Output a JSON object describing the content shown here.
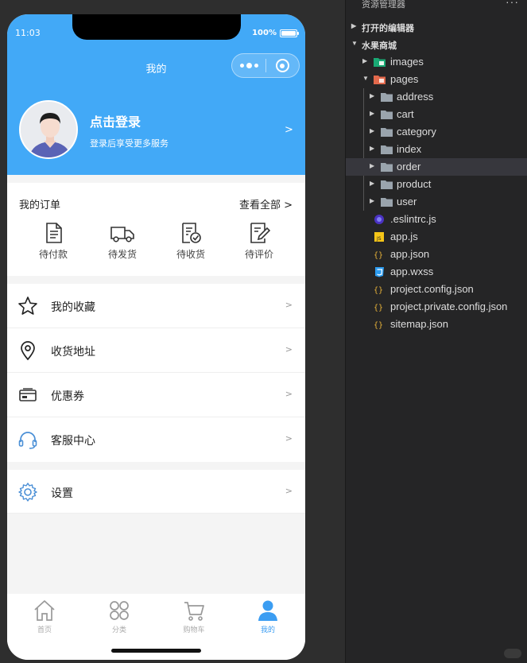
{
  "status": {
    "time": "11:03",
    "battery": "100%",
    "battery_level": 1.0
  },
  "nav": {
    "title": "我的"
  },
  "profile": {
    "login_title": "点击登录",
    "login_subtitle": "登录后享受更多服务",
    "arrow": ">"
  },
  "orders": {
    "title": "我的订单",
    "view_all": "查看全部 >",
    "items": [
      {
        "label": "待付款",
        "icon": "document-icon"
      },
      {
        "label": "待发货",
        "icon": "truck-icon"
      },
      {
        "label": "待收货",
        "icon": "checklist-icon"
      },
      {
        "label": "待评价",
        "icon": "review-pen-icon"
      }
    ]
  },
  "menu": {
    "items": [
      {
        "label": "我的收藏",
        "icon": "star-icon",
        "arrow": ">"
      },
      {
        "label": "收货地址",
        "icon": "location-pin-icon",
        "arrow": ">"
      },
      {
        "label": "优惠券",
        "icon": "coupon-icon",
        "arrow": ">"
      },
      {
        "label": "客服中心",
        "icon": "headset-icon",
        "arrow": ">"
      }
    ],
    "settings": {
      "label": "设置",
      "icon": "gear-icon",
      "arrow": ">"
    }
  },
  "tabbar": {
    "items": [
      {
        "label": "首页",
        "icon": "home-icon"
      },
      {
        "label": "分类",
        "icon": "category-icon"
      },
      {
        "label": "购物车",
        "icon": "cart-icon"
      },
      {
        "label": "我的",
        "icon": "user-icon",
        "active": true
      }
    ]
  },
  "explorer": {
    "header": "资源管理器",
    "more": "···",
    "open_editors": "打开的编辑器",
    "project": "水果商城",
    "tree": [
      {
        "name": "images",
        "type": "folder-images",
        "expanded": false
      },
      {
        "name": "pages",
        "type": "folder-pages",
        "expanded": true
      },
      {
        "name": "address",
        "type": "folder",
        "expanded": false
      },
      {
        "name": "cart",
        "type": "folder",
        "expanded": false
      },
      {
        "name": "category",
        "type": "folder",
        "expanded": false
      },
      {
        "name": "index",
        "type": "folder",
        "expanded": false
      },
      {
        "name": "order",
        "type": "folder",
        "expanded": false,
        "selected": true
      },
      {
        "name": "product",
        "type": "folder",
        "expanded": false
      },
      {
        "name": "user",
        "type": "folder",
        "expanded": false
      },
      {
        "name": ".eslintrc.js",
        "type": "eslint-file"
      },
      {
        "name": "app.js",
        "type": "js-file"
      },
      {
        "name": "app.json",
        "type": "json-file"
      },
      {
        "name": "app.wxss",
        "type": "wxss-file"
      },
      {
        "name": "project.config.json",
        "type": "json-file"
      },
      {
        "name": "project.private.config.json",
        "type": "json-file"
      },
      {
        "name": "sitemap.json",
        "type": "json-file"
      }
    ]
  },
  "colors": {
    "primary": "#42a9f7",
    "tab_active": "#3b9df2",
    "explorer_bg": "#252526",
    "selected_row": "#37373d"
  }
}
